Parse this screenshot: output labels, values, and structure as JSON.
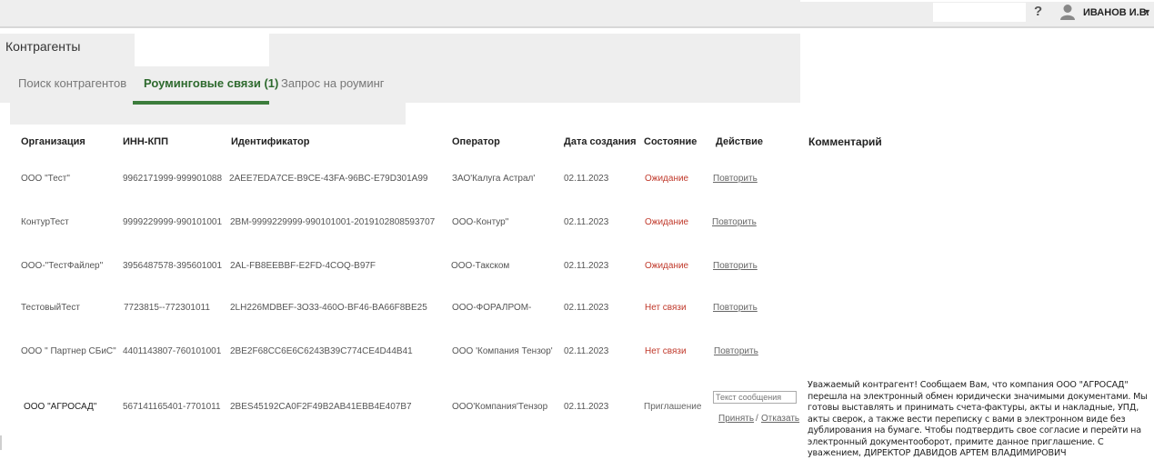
{
  "header": {
    "user_name": "ИВАНОВ И.В.",
    "help_label": "?",
    "caret": "▼"
  },
  "page": {
    "title": "Контрагенты"
  },
  "tabs": [
    {
      "label": "Поиск контрагентов",
      "active": false
    },
    {
      "label": "Роуминговые связи (1)",
      "active": true
    },
    {
      "label": "Запрос на роуминг",
      "active": false
    }
  ],
  "table": {
    "columns": [
      "Организация",
      "ИНН-КПП",
      "Идентификатор",
      "Оператор",
      "Дата создания",
      "Состояние",
      "Действие",
      "Комментарий"
    ],
    "rows": [
      {
        "org": "ООО \"Тест\"",
        "inn": "9962171999-999901088",
        "id": "2AEE7EDA7CE-B9CE-43FA-96BC-E79D301A99",
        "operator": "ЗАО'Калуга Астрал'",
        "date": "02.11.2023",
        "status": "Ожидание",
        "action": "Повторить"
      },
      {
        "org": "КонтурТест",
        "inn": "9999229999-990101001",
        "id": "2BM-9999229999-990101001-2019102808593707",
        "operator": "ООО-Контур\"",
        "date": "02.11.2023",
        "status": "Ожидание",
        "action": "Повторить"
      },
      {
        "org": "ООО-\"ТестФайлер\"",
        "inn": "3956487578-395601001",
        "id": "2AL-FB8EEBBF-E2FD-4COQ-B97F",
        "operator": "ООО-Такском",
        "date": "02.11.2023",
        "status": "Ожидание",
        "action": "Повторить"
      },
      {
        "org": "ТестовыйТест",
        "inn": "7723815--772301011",
        "id": "2LH226MDBEF-3O33-460O-BF46-BA66F8BE25",
        "operator": "ООО-ФОРАЛРОМ-",
        "date": "02.11.2023",
        "status": "Нет связи",
        "action": "Повторить"
      },
      {
        "org": "ООО \" Партнер СБиС\"",
        "inn": "4401143807-760101001",
        "id": "2BE2F68CC6E6C6243B39C774CE4D44B41",
        "operator": "ООО 'Компания Тензор'",
        "date": "02.11.2023",
        "status": "Нет связи",
        "action": "Повторить"
      },
      {
        "org": "ООО \"АГРОСАД\"",
        "inn": "567141165401-7701011",
        "id": "2BES45192CA0F2F49B2AB41EBB4E407B7",
        "operator": "ООО'Компания'Тензор",
        "date": "02.11.2023",
        "status": "Приглашение",
        "action_input_placeholder": "Текст сообщения",
        "accept": "Принять",
        "separator": "/",
        "reject": "Отказать",
        "comment": "Уважаемый контрагент! Сообщаем Вам, что компания ООО \"АГРОСАД\" перешла на электронный обмен юридически значимыми документами. Мы готовы выставлять и принимать счета-фактуры, акты и накладные, УПД, акты сверок, а также вести переписку с вами в электронном виде без дублирования на бумаге. Чтобы подтвердить свое согласие и перейти на электронный документооборот, примите данное приглашение. С уважением, ДИРЕКТОР ДАВИДОВ АРТЕМ ВЛАДИМИРОВИЧ"
      }
    ]
  },
  "colors": {
    "accent_green": "#3c7c3c",
    "status_red": "#c0392b",
    "panel_gray": "#eeeeee"
  }
}
